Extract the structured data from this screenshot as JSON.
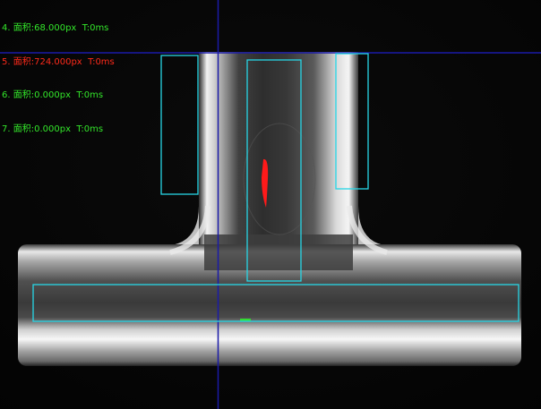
{
  "colors": {
    "ok": "#33e62a",
    "fail": "#ff2a1a",
    "roi_box": "#27d6e6",
    "crosshair": "#1a1aa8",
    "defect": "#ff1a1a",
    "mark": "#33dd33"
  },
  "results": [
    {
      "text": "4. 面积:68.000px  T:0ms",
      "status": "ok"
    },
    {
      "text": "5. 面积:724.000px  T:0ms",
      "status": "fail"
    },
    {
      "text": "6. 面积:0.000px  T:0ms",
      "status": "ok"
    },
    {
      "text": "7. 面积:0.000px  T:0ms",
      "status": "ok"
    }
  ]
}
